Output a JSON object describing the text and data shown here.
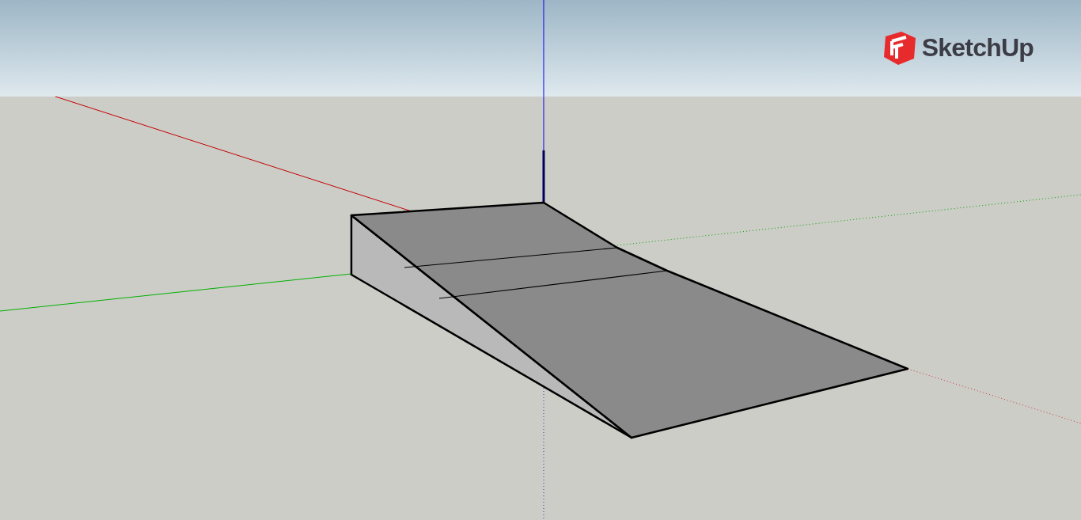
{
  "logo": {
    "text": "SketchUp"
  }
}
